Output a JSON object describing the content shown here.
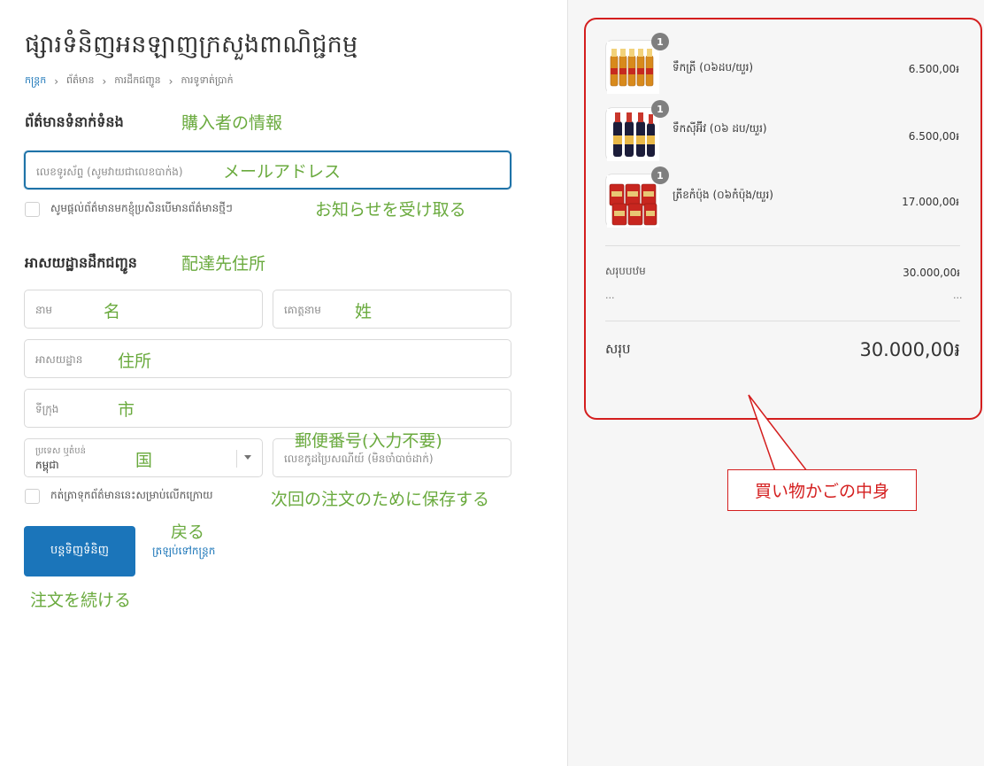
{
  "store": {
    "title": "ផ្សារទំនិញអនឡាញក្រសួងពាណិជ្ជកម្ម"
  },
  "breadcrumb": [
    {
      "label": "កន្ត្រក",
      "link": true
    },
    {
      "label": "ព័ត៌មាន",
      "link": false
    },
    {
      "label": "ការដឹកជញ្ជូន",
      "link": false
    },
    {
      "label": "ការទូទាត់ប្រាក់",
      "link": false
    }
  ],
  "breadcrumb_sep": "›",
  "contact": {
    "title": "ព័ត៌មានទំនាក់ទំនង",
    "title_jp": "購入者の情報",
    "email_placeholder": "លេខទូរស័ព្ទ (សូមវាយជាលេខបាក់ង)",
    "email_jp": "メールアドレス",
    "newsletter_label": "សូមផ្តល់ព័ត៌មានមកខ្ញុំប្រសិនបើមានព័ត៌មានថ្មីៗ",
    "newsletter_jp": "お知らせを受け取る"
  },
  "shipping": {
    "title": "អាសយដ្ឋានដឹកជញ្ជូន",
    "title_jp": "配達先住所",
    "first_name_placeholder": "នាម",
    "first_name_jp": "名",
    "last_name_placeholder": "គោត្តនាម",
    "last_name_jp": "姓",
    "address_placeholder": "អាសយដ្ឋាន",
    "address_jp": "住所",
    "city_placeholder": "ទីក្រុង",
    "city_jp": "市",
    "country_label": "ប្រទេស ឬតំបន់",
    "country_value": "កម្ពុជា",
    "country_jp": "国",
    "postal_placeholder": "លេខកូដប្រៃសណីយ៍ (មិនចាំបាច់ដាក់)",
    "postal_jp": "郵便番号(入力不要)",
    "save_label": "កត់ត្រាទុកព័ត៌មាននេះសម្រាប់លើកក្រោយ",
    "save_jp": "次回の注文のために保存する"
  },
  "actions": {
    "continue_label": "បន្តទិញទំនិញ",
    "continue_jp": "注文を続ける",
    "return_label": "ត្រឡប់ទៅកន្ត្រក",
    "return_jp": "戻る"
  },
  "cart": {
    "items": [
      {
        "name": "ទឹកត្រី (០៦ដប/យួរ)",
        "price": "6.500,00៛",
        "qty": "1"
      },
      {
        "name": "ទឹកស៊ីអ៊ីវ (០៦ ដប/យួរ)",
        "price": "6.500,00៛",
        "qty": "1"
      },
      {
        "name": "ត្រីខកំប៉ុង (០៦កំប៉ុង/យួរ)",
        "price": "17.000,00៛",
        "qty": "1"
      }
    ],
    "subtotal_label": "សរុបបឋម",
    "subtotal_value": "30.000,00៛",
    "shipping_dots": "...",
    "total_label": "សរុប",
    "total_value": "30.000,00៛",
    "annotation_jp": "買い物かごの中身"
  },
  "colors": {
    "accent": "#1b75ba",
    "annotation_green": "#6aaa3e",
    "annotation_red": "#d41e1e"
  }
}
